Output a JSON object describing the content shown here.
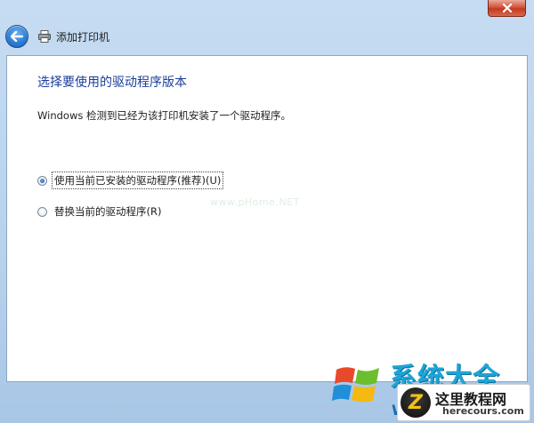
{
  "window": {
    "title": "添加打印机",
    "close_button_color": "#c23a1f"
  },
  "page": {
    "heading": "选择要使用的驱动程序版本",
    "description": "Windows 检测到已经为该打印机安装了一个驱动程序。"
  },
  "options": [
    {
      "label": "使用当前已安装的驱动程序(推荐)(U)",
      "selected": true
    },
    {
      "label": "替换当前的驱动程序(R)",
      "selected": false
    }
  ],
  "watermark": {
    "text": "www.pHome.NET",
    "logo_text": "系统大全",
    "logo_letter": "W",
    "site_name": "这里教程网",
    "site_domain": "herecours.com",
    "site_letter": "Z"
  },
  "icons": {
    "back": "back-arrow-icon",
    "printer": "printer-icon",
    "close": "close-icon"
  },
  "colors": {
    "heading": "#1a3e9a",
    "frame": "#b9d1ea",
    "logo_blue": "#1da5d8"
  }
}
